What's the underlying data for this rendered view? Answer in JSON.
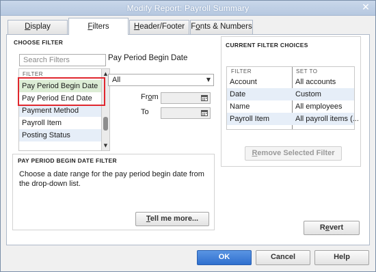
{
  "window": {
    "title": "Modify Report: Payroll Summary",
    "close_glyph": "✕"
  },
  "tabs": [
    {
      "label_pre": "",
      "label_u": "D",
      "label_post": "isplay"
    },
    {
      "label_pre": "",
      "label_u": "F",
      "label_post": "ilters"
    },
    {
      "label_pre": "",
      "label_u": "H",
      "label_post": "eader/Footer"
    },
    {
      "label_pre": "F",
      "label_u": "o",
      "label_post": "nts & Numbers"
    }
  ],
  "choose_filter": {
    "heading": "CHOOSE FILTER",
    "search_placeholder": "Search Filters",
    "list_header": "FILTER",
    "items": [
      "Pay Period Begin Date",
      "Pay Period End Date",
      "Payment Method",
      "Payroll Item",
      "Posting Status"
    ],
    "selected_index": 0,
    "field_title": "Pay Period Begin Date",
    "range_value": "All",
    "from_label_pre": "Fr",
    "from_label_u": "o",
    "from_label_post": "m",
    "to_label": "To"
  },
  "description": {
    "heading": "PAY PERIOD BEGIN DATE FILTER",
    "text": "Choose a date range for the pay period begin date from the drop-down list.",
    "tell_me_pre": "",
    "tell_me_u": "T",
    "tell_me_post": "ell me more..."
  },
  "current_filters": {
    "heading": "CURRENT FILTER CHOICES",
    "col_filter": "FILTER",
    "col_set_to": "SET TO",
    "rows": [
      {
        "filter": "Account",
        "set_to": "All accounts"
      },
      {
        "filter": "Date",
        "set_to": "Custom"
      },
      {
        "filter": "Name",
        "set_to": "All employees"
      },
      {
        "filter": "Payroll Item",
        "set_to": "All payroll items (..."
      }
    ],
    "remove_pre": "",
    "remove_u": "R",
    "remove_post": "emove Selected Filter"
  },
  "buttons": {
    "revert_pre": "R",
    "revert_u": "e",
    "revert_post": "vert",
    "ok": "OK",
    "cancel": "Cancel",
    "help": "Help"
  },
  "colors": {
    "selected_row": "#dcedd5",
    "alt_row": "#e6eef8",
    "highlight_box": "#e0262d",
    "primary_button": "#2f6fcf"
  }
}
